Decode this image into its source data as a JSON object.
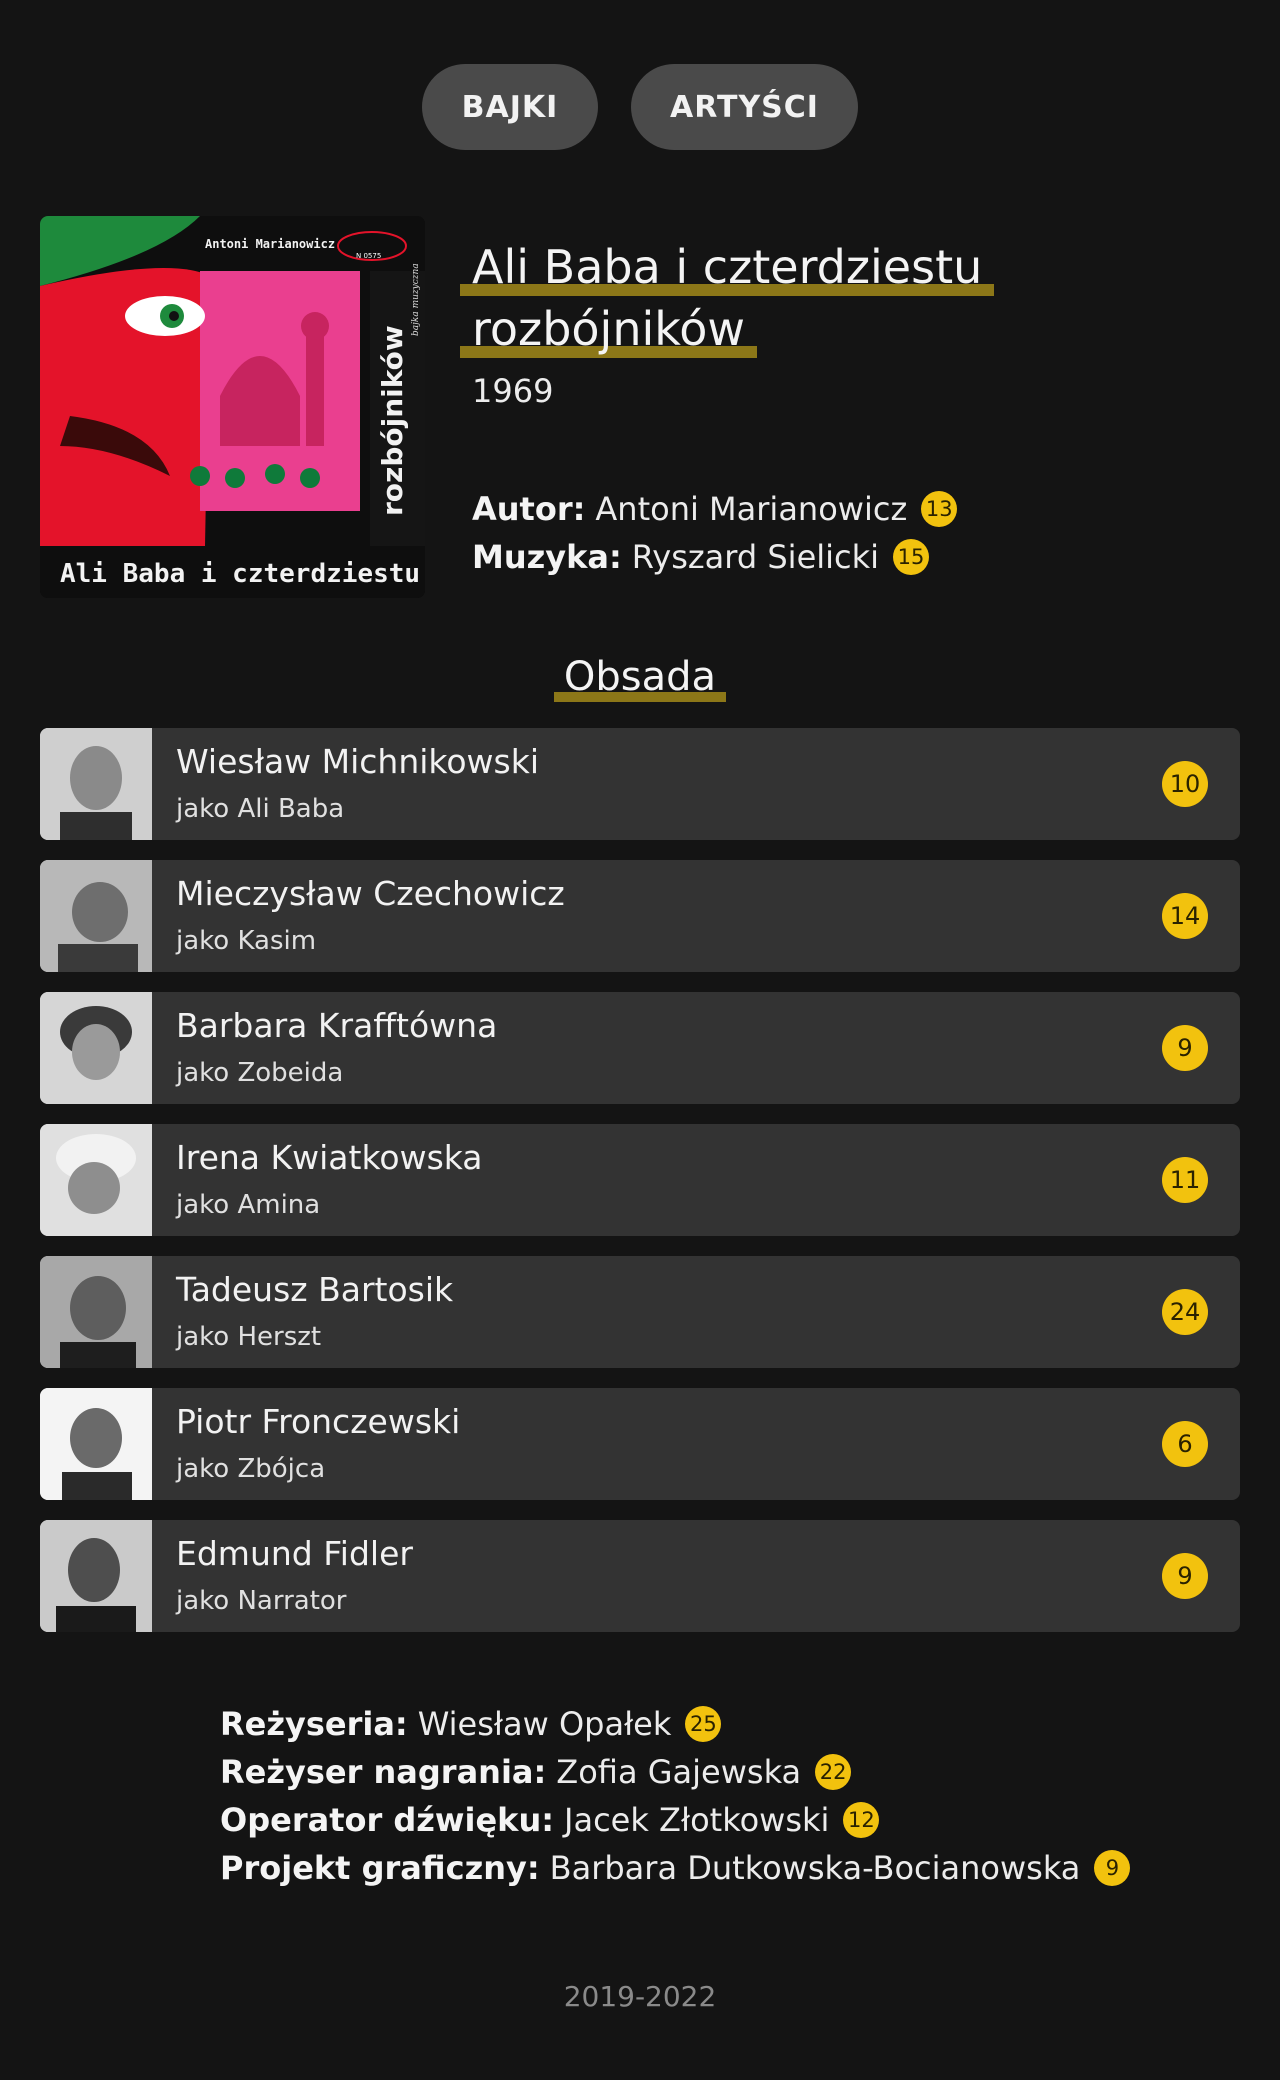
{
  "nav": {
    "bajki": "BAJKI",
    "artysci": "ARTYŚCI"
  },
  "album": {
    "title_line1": "Ali Baba i czterdziestu",
    "title_line2": "rozbójników",
    "year": "1969",
    "cover": {
      "author_text": "Antoni Marianowicz",
      "title_text": "Ali Baba i czterdziestu",
      "spine_text": "rozbójników",
      "spine_small": "bajka muzyczna",
      "label_text": "N 0575"
    },
    "credits": [
      {
        "label": "Autor:",
        "name": "Antoni Marianowicz",
        "count": "13"
      },
      {
        "label": "Muzyka:",
        "name": "Ryszard Sielicki",
        "count": "15"
      }
    ]
  },
  "cast_section": {
    "title": "Obsada",
    "items": [
      {
        "name": "Wiesław Michnikowski",
        "role": "jako Ali Baba",
        "count": "10"
      },
      {
        "name": "Mieczysław Czechowicz",
        "role": "jako Kasim",
        "count": "14"
      },
      {
        "name": "Barbara Krafftówna",
        "role": "jako Zobeida",
        "count": "9"
      },
      {
        "name": "Irena Kwiatkowska",
        "role": "jako Amina",
        "count": "11"
      },
      {
        "name": "Tadeusz Bartosik",
        "role": "jako Herszt",
        "count": "24"
      },
      {
        "name": "Piotr Fronczewski",
        "role": "jako Zbójca",
        "count": "6"
      },
      {
        "name": "Edmund Fidler",
        "role": "jako Narrator",
        "count": "9"
      }
    ]
  },
  "bottom_credits": [
    {
      "label": "Reżyseria:",
      "name": "Wiesław Opałek",
      "count": "25"
    },
    {
      "label": "Reżyser nagrania:",
      "name": "Zofia Gajewska",
      "count": "22"
    },
    {
      "label": "Operator dźwięku:",
      "name": "Jacek Złotkowski",
      "count": "12"
    },
    {
      "label": "Projekt graficzny:",
      "name": "Barbara Dutkowska-Bocianowska",
      "count": "9"
    }
  ],
  "footer": {
    "years": "2019-2022"
  },
  "colors": {
    "background": "#141414",
    "card": "#333333",
    "badge": "#f2c20e",
    "underline": "#8c7718"
  }
}
